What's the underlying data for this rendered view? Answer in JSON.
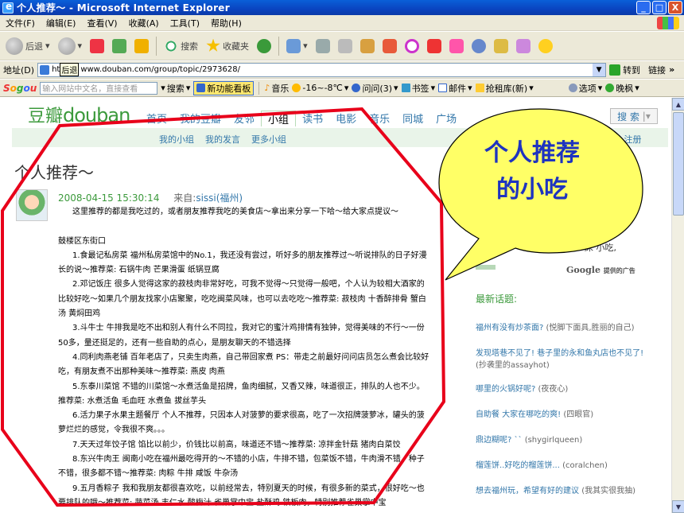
{
  "window": {
    "title": "个人推荐～ - Microsoft Internet Explorer",
    "buttons": [
      "_",
      "□",
      "X"
    ]
  },
  "menu": [
    "文件(F)",
    "编辑(E)",
    "查看(V)",
    "收藏(A)",
    "工具(T)",
    "帮助(H)"
  ],
  "toolbar": {
    "back": "后退",
    "search": "搜索",
    "favorites": "收藏夹"
  },
  "address": {
    "label": "地址(D)",
    "tooltip": "后退",
    "url_prefix": "ht",
    "url": "www.douban.com/group/topic/2973628/",
    "go": "转到",
    "links": "链接"
  },
  "sogou": {
    "placeholder": "输入网站中文名，直接查看",
    "search": "搜索",
    "new_feature": "新功能看板",
    "music": "音乐",
    "weather": "-16~-8℃",
    "ask": "问问(3)",
    "bookmarks": "书签",
    "mail": "邮件",
    "lottery": "抢租库(新)",
    "options": "选项",
    "wanfeng": "晚枫"
  },
  "douban": {
    "logo_cn": "豆瓣",
    "logo_en": "douban",
    "nav": [
      "首页",
      "我的豆瓣",
      "友邻",
      "小组",
      "读书",
      "电影",
      "音乐",
      "同城",
      "广场"
    ],
    "active_nav": "小组",
    "subnav": [
      "我的小组",
      "我的发言",
      "更多小组"
    ],
    "search_button": "搜 索",
    "login": "或 注册"
  },
  "post": {
    "title": "个人推荐～",
    "date": "2008-04-15 15:30:14",
    "from_label": "来自:",
    "user": "sissi(福州)",
    "lines": [
      "这里推荐的都是我吃过的，或者朋友推荐我吃的美食店～拿出来分享一下哈～给大家点提议～",
      "",
      "鼓楼区东街口",
      "1.食最记私房菜  福州私房菜馆中的No.1，我还没有尝过，听好多的朋友推荐过～听说排队的日子好漫",
      "长的说～推荐菜: 石锅牛肉  芒果滑蛋  纸锅豆腐",
      "2.邓记饭庄  很多人觉得这家的菽枝肉非常好吃，可我不觉得～只觉得一般吧，个人认为较相大酒家的",
      "比较好吃～如果几个朋友找家小店聚聚，吃吃闽菜风味，也可以去吃吃～推荐菜: 菽枝肉  十香醉排骨  蟹白",
      "汤  黄焖田鸡",
      "3.斗牛士  牛排我是吃不出和别人有什么不同拉，我对它的蜜汁鸡排情有独钟，觉得美味的不行～一份",
      "50多，量还挺足的，还有一些自助的点心，是朋友聊天的不错选择",
      "4.同利肉燕老铺  百年老店了，只卖生肉燕，自己带回家煮 PS：带走之前最好问问店员怎么煮会比较好",
      "吃，有朋友煮不出那种美味～推荐菜: 燕皮  肉燕",
      "5.东泰川菜馆  不错的川菜馆～水煮活鱼是招牌，鱼肉细腻，又香又辣，味道很正，排队的人也不少。",
      "推荐菜: 水煮活鱼  毛血旺  水煮鱼  拔丝芋头",
      "6.活力果子水果主题餐厅  个人不推荐，只因本人对菠萝的要求很高，吃了一次招牌菠萝冰，罐头的菠",
      "萝烂烂的感觉，令我很不爽。。。",
      "7.天天过年饺子馆  馅比以前少，价钱比以前高，味道还不错～推荐菜: 凉拌金针菇  猪肉白菜饺",
      "8.东兴牛肉王  闽南小吃在福州最吃得开的～不错的小店，牛排不错，包菜饭不错，牛肉滑不错，种子",
      "不错，很多都不错～推荐菜: 肉粽  牛排  咸饭  牛杂汤",
      "9.五月香粽子  我和我朋友都很喜欢吃，以前经常去，特别夏天的时候，有很多新的菜式，很好吃～也",
      "要排队的哦～推荐菜: 蔬菜汤  丰仁水  酸梅汁  雀巢掌中宝  盐酥鸡  铁板肉，特别推荐雀巢掌中宝"
    ]
  },
  "sidebar": {
    "ad_text": "床 小吃,",
    "google": "Google",
    "google_sub": "提供的广告",
    "latest": "最新话题:",
    "topics": [
      {
        "title": "福州有没有炒茶面?",
        "author": "(悦脚下面具,胜丽的自己)"
      },
      {
        "title": "发现塔巷不见了! 巷子里的永和鱼丸店也不见了!",
        "author": "(抄袭里的assayhot)"
      },
      {
        "title": "哪里的火锅好呢?",
        "author": "(夜夜心)"
      },
      {
        "title": "自助餐 大家在哪吃的爽!",
        "author": "(四眼官)"
      },
      {
        "title": "鼎边糊呢? ``",
        "author": "(shygirlqueen)"
      },
      {
        "title": "榴莲饼..好吃的榴莲饼...",
        "author": "(coralchen)"
      },
      {
        "title": "想去福州玩，希望有好的建议",
        "author": "(我其实很我抽)"
      }
    ]
  },
  "callout": {
    "line1": "个人推荐",
    "line2": "的小吃"
  },
  "colors": {
    "douban_green": "#3c9a3c",
    "link_blue": "#3377aa",
    "annotation_red": "#e8001a",
    "callout_yellow": "#ffff66",
    "callout_text": "#1e33c0"
  }
}
